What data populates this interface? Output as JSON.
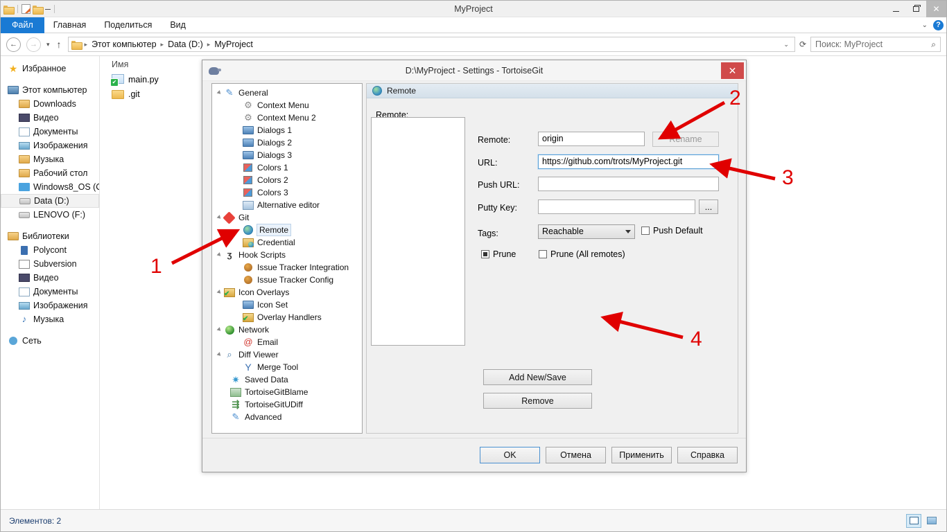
{
  "explorer": {
    "window_title": "MyProject",
    "quick_access": [
      {
        "name": "folder-icon",
        "label": "Folder"
      },
      {
        "name": "properties-icon",
        "label": "Properties"
      },
      {
        "name": "new-folder-icon",
        "label": "New folder"
      },
      {
        "name": "customize-qat-icon",
        "label": "Customize Quick Access Toolbar"
      }
    ],
    "window_buttons": {
      "minimize": "—",
      "maximize": "❐",
      "close": "✕"
    },
    "ribbon_tabs": [
      {
        "label": "Файл",
        "active": true
      },
      {
        "label": "Главная",
        "active": false
      },
      {
        "label": "Поделиться",
        "active": false
      },
      {
        "label": "Вид",
        "active": false
      }
    ],
    "ribbon_right": {
      "collapse": "⌄",
      "help": "?"
    },
    "address": {
      "back": "←",
      "forward": "→",
      "recent": "▾",
      "up": "↑",
      "crumbs": [
        "Этот компьютер",
        "Data (D:)",
        "MyProject"
      ],
      "separator": "▸",
      "dropdown": "⌄",
      "refresh": "⟳"
    },
    "search": {
      "placeholder": "Поиск: MyProject",
      "value": "",
      "icon": "search-icon"
    },
    "sidebar": [
      {
        "label": "Избранное",
        "level": 0,
        "icon": "star-icon",
        "selected": false
      },
      {
        "gap": true
      },
      {
        "label": "Этот компьютер",
        "level": 0,
        "icon": "computer-icon",
        "selected": false
      },
      {
        "label": "Downloads",
        "level": 1,
        "icon": "downloads-folder-icon",
        "selected": false
      },
      {
        "label": "Видео",
        "level": 1,
        "icon": "video-folder-icon",
        "selected": false
      },
      {
        "label": "Документы",
        "level": 1,
        "icon": "documents-folder-icon",
        "selected": false
      },
      {
        "label": "Изображения",
        "level": 1,
        "icon": "pictures-folder-icon",
        "selected": false
      },
      {
        "label": "Музыка",
        "level": 1,
        "icon": "music-folder-icon",
        "selected": false
      },
      {
        "label": "Рабочий стол",
        "level": 1,
        "icon": "desktop-folder-icon",
        "selected": false
      },
      {
        "label": "Windows8_OS (C",
        "level": 1,
        "icon": "windows-drive-icon",
        "selected": false
      },
      {
        "label": "Data (D:)",
        "level": 1,
        "icon": "drive-icon",
        "selected": true
      },
      {
        "label": "LENOVO (F:)",
        "level": 1,
        "icon": "drive-icon",
        "selected": false
      },
      {
        "gap": true
      },
      {
        "label": "Библиотеки",
        "level": 0,
        "icon": "libraries-icon",
        "selected": false
      },
      {
        "label": "Polycont",
        "level": 1,
        "icon": "polycont-icon",
        "selected": false
      },
      {
        "label": "Subversion",
        "level": 1,
        "icon": "subversion-icon",
        "selected": false
      },
      {
        "label": "Видео",
        "level": 1,
        "icon": "video-library-icon",
        "selected": false
      },
      {
        "label": "Документы",
        "level": 1,
        "icon": "documents-library-icon",
        "selected": false
      },
      {
        "label": "Изображения",
        "level": 1,
        "icon": "pictures-library-icon",
        "selected": false
      },
      {
        "label": "Музыка",
        "level": 1,
        "icon": "music-library-icon",
        "selected": false
      },
      {
        "gap": true
      },
      {
        "label": "Сеть",
        "level": 0,
        "icon": "network-icon",
        "selected": false
      }
    ],
    "file_list": {
      "column_header": "Имя",
      "rows": [
        {
          "name": "main.py",
          "icon": "python-file-icon"
        },
        {
          "name": ".git",
          "icon": "folder-icon"
        }
      ]
    },
    "status": {
      "text": "Элементов: 2",
      "view_buttons": [
        {
          "name": "details-view-button",
          "active": true
        },
        {
          "name": "thumbnail-view-button",
          "active": false
        }
      ]
    }
  },
  "dialog": {
    "title": "D:\\MyProject - Settings - TortoiseGit",
    "app_icon": "tortoisegit-icon",
    "close_label": "✕",
    "tree": [
      {
        "label": "General",
        "level": 0,
        "icon": "wrench-icon",
        "expander": true,
        "selected": false
      },
      {
        "label": "Context Menu",
        "level": 1,
        "icon": "gear-icon",
        "expander": false,
        "selected": false
      },
      {
        "label": "Context Menu 2",
        "level": 1,
        "icon": "gear-icon",
        "expander": false,
        "selected": false
      },
      {
        "label": "Dialogs 1",
        "level": 1,
        "icon": "dialogs-icon",
        "expander": false,
        "selected": false
      },
      {
        "label": "Dialogs 2",
        "level": 1,
        "icon": "dialogs-icon",
        "expander": false,
        "selected": false
      },
      {
        "label": "Dialogs 3",
        "level": 1,
        "icon": "dialogs-icon",
        "expander": false,
        "selected": false
      },
      {
        "label": "Colors 1",
        "level": 1,
        "icon": "colors-icon",
        "expander": false,
        "selected": false
      },
      {
        "label": "Colors 2",
        "level": 1,
        "icon": "colors-icon",
        "expander": false,
        "selected": false
      },
      {
        "label": "Colors 3",
        "level": 1,
        "icon": "colors-icon",
        "expander": false,
        "selected": false
      },
      {
        "label": "Alternative editor",
        "level": 1,
        "icon": "editor-icon",
        "expander": false,
        "selected": false
      },
      {
        "label": "Git",
        "level": 0,
        "icon": "git-icon",
        "expander": true,
        "selected": false
      },
      {
        "label": "Remote",
        "level": 1,
        "icon": "globe-icon",
        "expander": false,
        "selected": true
      },
      {
        "label": "Credential",
        "level": 1,
        "icon": "credential-icon",
        "expander": false,
        "selected": false
      },
      {
        "label": "Hook Scripts",
        "level": 0,
        "icon": "hook-icon",
        "expander": true,
        "selected": false
      },
      {
        "label": "Issue Tracker Integration",
        "level": 1,
        "icon": "bug-icon",
        "expander": false,
        "selected": false
      },
      {
        "label": "Issue Tracker Config",
        "level": 1,
        "icon": "bug-icon",
        "expander": false,
        "selected": false
      },
      {
        "label": "Icon Overlays",
        "level": 0,
        "icon": "overlay-icon",
        "expander": true,
        "selected": false
      },
      {
        "label": "Icon Set",
        "level": 1,
        "icon": "icon-set-icon",
        "expander": false,
        "selected": false
      },
      {
        "label": "Overlay Handlers",
        "level": 1,
        "icon": "overlay-icon",
        "expander": false,
        "selected": false
      },
      {
        "label": "Network",
        "level": 0,
        "icon": "network-globe-icon",
        "expander": true,
        "selected": false
      },
      {
        "label": "Email",
        "level": 1,
        "icon": "at-icon",
        "expander": false,
        "selected": false
      },
      {
        "label": "Diff Viewer",
        "level": 0,
        "icon": "diff-viewer-icon",
        "expander": true,
        "selected": false
      },
      {
        "label": "Merge Tool",
        "level": 1,
        "icon": "merge-tool-icon",
        "expander": false,
        "selected": false
      },
      {
        "label": "Saved Data",
        "level": 0,
        "icon": "saved-data-icon",
        "expander": false,
        "selected": false
      },
      {
        "label": "TortoiseGitBlame",
        "level": 0,
        "icon": "blame-icon",
        "expander": false,
        "selected": false
      },
      {
        "label": "TortoiseGitUDiff",
        "level": 0,
        "icon": "udiff-icon",
        "expander": false,
        "selected": false
      },
      {
        "label": "Advanced",
        "level": 0,
        "icon": "advanced-icon",
        "expander": false,
        "selected": false
      }
    ],
    "page": {
      "header": "Remote",
      "header_icon": "globe-icon",
      "remote_list_label": "Remote:",
      "remote_list_items": [],
      "fields": {
        "remote_label": "Remote:",
        "remote_value": "origin",
        "rename_button": "Rename",
        "url_label": "URL:",
        "url_value": "https://github.com/trots/MyProject.git",
        "push_url_label": "Push URL:",
        "push_url_value": "",
        "putty_key_label": "Putty Key:",
        "putty_key_value": "",
        "putty_browse_button": "...",
        "tags_label": "Tags:",
        "tags_value": "Reachable",
        "push_default_label": "Push Default",
        "push_default_checked": false,
        "prune_label": "Prune",
        "prune_state": "indeterminate",
        "prune_all_label": "Prune (All remotes)",
        "prune_all_checked": false
      },
      "actions": {
        "add_new_save": "Add New/Save",
        "add_new_save_accel": "A",
        "remove": "Remove",
        "remove_accel": "R"
      }
    },
    "bottom_buttons": [
      {
        "label": "OK",
        "default": true
      },
      {
        "label": "Отмена",
        "default": false
      },
      {
        "label": "Применить",
        "default": false
      },
      {
        "label": "Справка",
        "default": false
      }
    ]
  },
  "annotations": [
    {
      "number": "1",
      "target": "tree-item-remote"
    },
    {
      "number": "2",
      "target": "remote-name-input"
    },
    {
      "number": "3",
      "target": "url-input"
    },
    {
      "number": "4",
      "target": "add-new-save-button"
    }
  ],
  "colors": {
    "accent": "#1a7ad4",
    "annotation_red": "#e00000",
    "close_red": "#d04a4a",
    "status_text": "#1a3c6e"
  }
}
